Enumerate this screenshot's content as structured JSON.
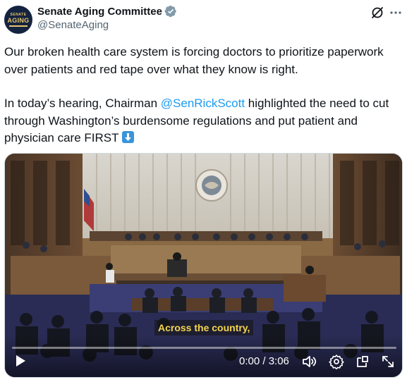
{
  "author": {
    "display_name": "Senate Aging Committee",
    "handle": "@SenateAging",
    "avatar_text_top": "SENATE",
    "avatar_text_main": "AGING"
  },
  "tweet": {
    "line1": "Our broken health care system is forcing doctors to prioritize paperwork over patients and red tape over what they know is right.",
    "line2_prefix": "In today’s hearing, Chairman ",
    "line2_mention": "@SenRickScott",
    "line2_suffix": " highlighted the need to cut through Washington’s burdensome regulations and put patient and physician care FIRST "
  },
  "video": {
    "caption": "Across the country,",
    "time": "0:00 / 3:06",
    "progress": 0.0
  },
  "colors": {
    "accent": "#1d9bf0",
    "caption_text": "#f2d54d",
    "verified_badge": "#829aab"
  },
  "icons": {
    "verified": "verified-badge-icon",
    "grok": "grok-icon",
    "more": "more-icon",
    "play": "play-icon",
    "volume": "volume-icon",
    "settings": "settings-icon",
    "popout": "popout-icon",
    "fullscreen": "fullscreen-icon"
  }
}
